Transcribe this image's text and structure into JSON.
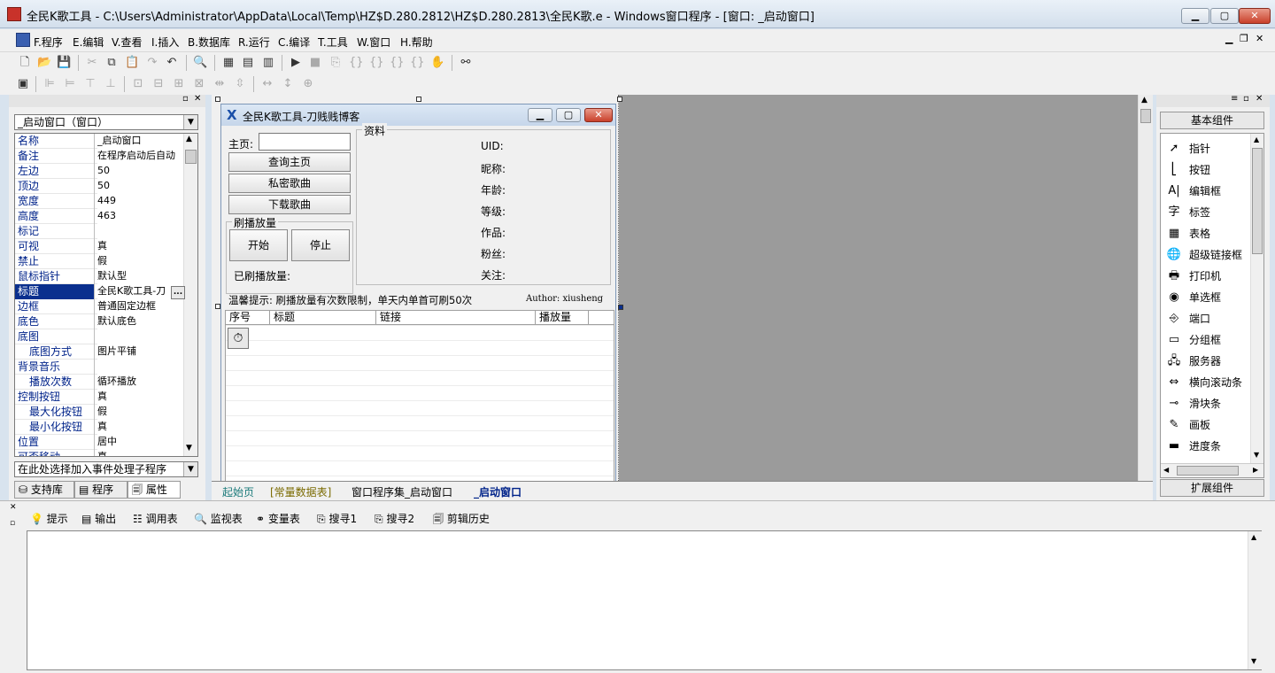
{
  "window": {
    "title": "全民K歌工具 - C:\\Users\\Administrator\\AppData\\Local\\Temp\\HZ$D.280.2812\\HZ$D.280.2813\\全民K歌.e - Windows窗口程序 - [窗口: _启动窗口]",
    "min": "▁",
    "max": "▢",
    "close": "✕"
  },
  "menu": [
    "F.程序",
    "E.编辑",
    "V.查看",
    "I.插入",
    "B.数据库",
    "R.运行",
    "C.编译",
    "T.工具",
    "W.窗口",
    "H.帮助"
  ],
  "property_panel": {
    "object_combo": "_启动窗口（窗口）",
    "rows": [
      {
        "name": "名称",
        "value": "_启动窗口"
      },
      {
        "name": "备注",
        "value": "在程序启动后自动"
      },
      {
        "name": "左边",
        "value": "50"
      },
      {
        "name": "顶边",
        "value": "50"
      },
      {
        "name": "宽度",
        "value": "449"
      },
      {
        "name": "高度",
        "value": "463"
      },
      {
        "name": "标记",
        "value": ""
      },
      {
        "name": "可视",
        "value": "真"
      },
      {
        "name": "禁止",
        "value": "假"
      },
      {
        "name": "鼠标指针",
        "value": "默认型"
      },
      {
        "name": "标题",
        "value": "全民K歌工具-刀"
      },
      {
        "name": "边框",
        "value": "普通固定边框"
      },
      {
        "name": "底色",
        "value": "默认底色"
      },
      {
        "name": "底图",
        "value": ""
      },
      {
        "name": "底图方式",
        "value": "图片平铺"
      },
      {
        "name": "背景音乐",
        "value": ""
      },
      {
        "name": "播放次数",
        "value": "循环播放"
      },
      {
        "name": "控制按钮",
        "value": "真"
      },
      {
        "name": "最大化按钮",
        "value": "假"
      },
      {
        "name": "最小化按钮",
        "value": "真"
      },
      {
        "name": "位置",
        "value": "居中"
      },
      {
        "name": "可否移动",
        "value": "真"
      }
    ],
    "selected_row": "标题",
    "ellipsis": "...",
    "event_combo": "在此处选择加入事件处理子程序",
    "tabs": [
      "支持库",
      "程序",
      "属性"
    ]
  },
  "design_form": {
    "title": "全民K歌工具-刀贱贱博客",
    "homepage_label": "主页:",
    "buttons": [
      "查询主页",
      "私密歌曲",
      "下载歌曲"
    ],
    "boost_group": "刷播放量",
    "start": "开始",
    "stop": "停止",
    "played_label": "已刷播放量:",
    "info_group": "资料",
    "info_fields": [
      "UID:",
      "昵称:",
      "年龄:",
      "等级:",
      "作品:",
      "粉丝:",
      "关注:"
    ],
    "tip": "温馨提示: 刷播放量有次数限制，单天内单首可刷50次",
    "author": "Author: xiusheng",
    "table_headers": [
      "序号",
      "标题",
      "链接",
      "播放量"
    ]
  },
  "doc_tabs": [
    "起始页",
    "[常量数据表]",
    "窗口程序集_启动窗口",
    "_启动窗口"
  ],
  "component_box": {
    "header": "基本组件",
    "items": [
      {
        "label": "指针",
        "icon": "pointer-icon"
      },
      {
        "label": "按钮",
        "icon": "button-icon"
      },
      {
        "label": "编辑框",
        "icon": "editbox-icon"
      },
      {
        "label": "标签",
        "icon": "label-icon"
      },
      {
        "label": "表格",
        "icon": "table-icon"
      },
      {
        "label": "超级链接框",
        "icon": "hyperlink-icon"
      },
      {
        "label": "打印机",
        "icon": "printer-icon"
      },
      {
        "label": "单选框",
        "icon": "radio-icon"
      },
      {
        "label": "端口",
        "icon": "port-icon"
      },
      {
        "label": "分组框",
        "icon": "groupbox-icon"
      },
      {
        "label": "服务器",
        "icon": "server-icon"
      },
      {
        "label": "横向滚动条",
        "icon": "hscroll-icon"
      },
      {
        "label": "滑块条",
        "icon": "slider-icon"
      },
      {
        "label": "画板",
        "icon": "canvas-icon"
      },
      {
        "label": "进度条",
        "icon": "progress-icon"
      }
    ],
    "footer": "扩展组件"
  },
  "bottom_tabs": [
    "提示",
    "输出",
    "调用表",
    "监视表",
    "变量表",
    "搜寻1",
    "搜寻2",
    "剪辑历史"
  ],
  "colors": {
    "selection": "#0a2f8e",
    "design_bg": "#9b9b9b",
    "prop_name": "#00238a"
  }
}
